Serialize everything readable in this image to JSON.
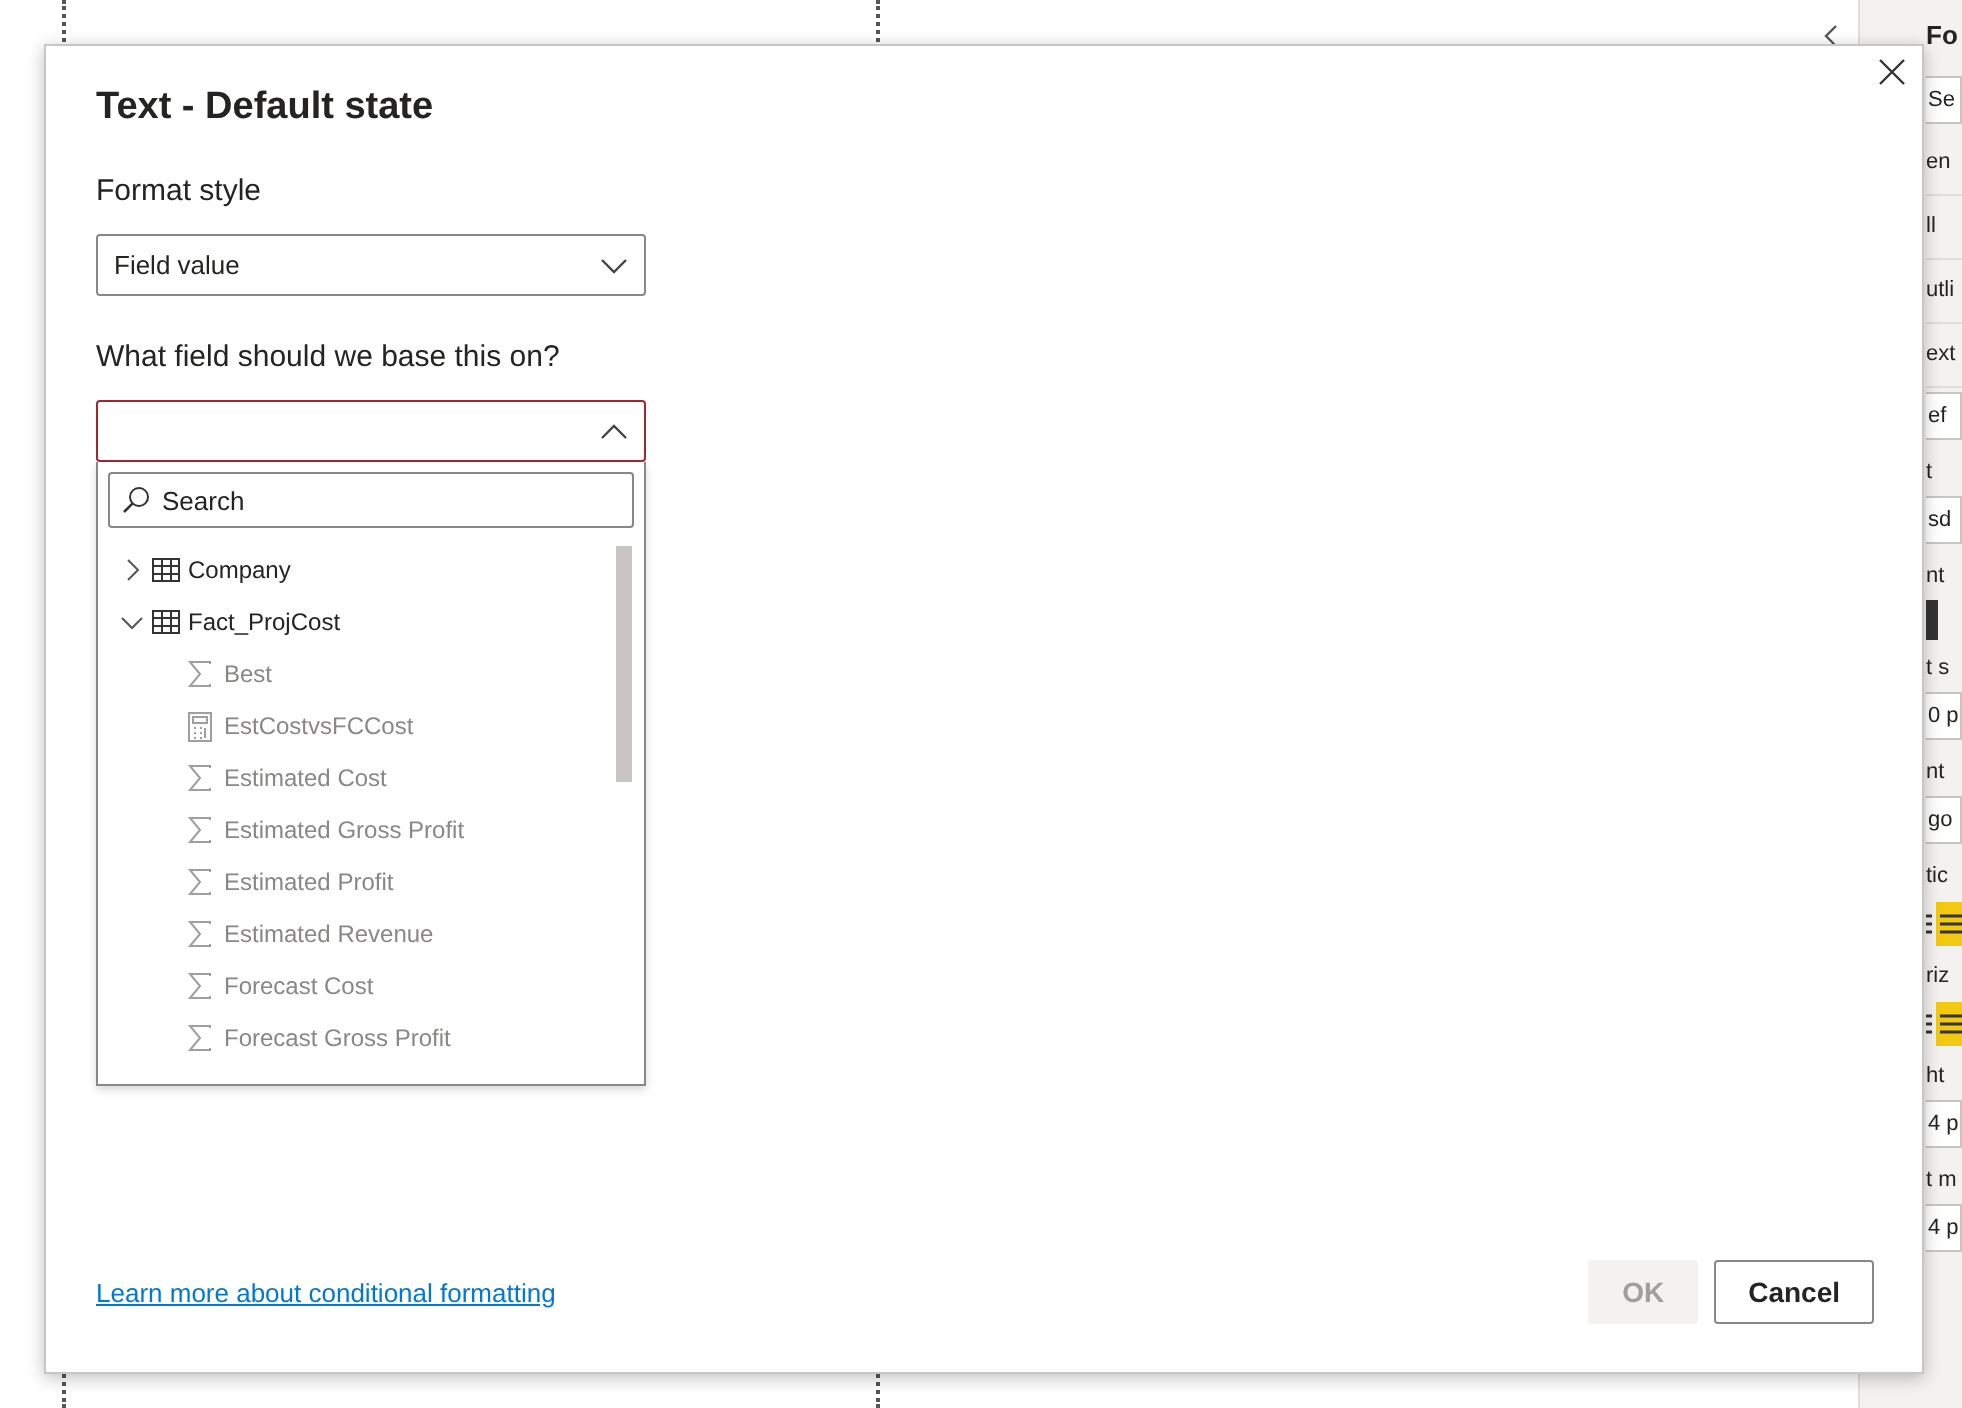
{
  "pane": {
    "title": "Fo",
    "rows": [
      {
        "kind": "field",
        "text": "Se"
      },
      {
        "kind": "section",
        "text": "en"
      },
      {
        "kind": "section",
        "text": "ll"
      },
      {
        "kind": "section",
        "text": "utli"
      },
      {
        "kind": "section",
        "text": "ext"
      },
      {
        "kind": "field",
        "text": "ef"
      },
      {
        "kind": "label",
        "text": "t"
      },
      {
        "kind": "field",
        "text": "sd"
      },
      {
        "kind": "label",
        "text": "nt"
      },
      {
        "kind": "swatch"
      },
      {
        "kind": "label",
        "text": "t s"
      },
      {
        "kind": "field",
        "text": "0",
        "unit": "p"
      },
      {
        "kind": "label",
        "text": "nt"
      },
      {
        "kind": "field",
        "text": "go"
      },
      {
        "kind": "label",
        "text": "tic"
      },
      {
        "kind": "align"
      },
      {
        "kind": "label",
        "text": "riz"
      },
      {
        "kind": "align"
      },
      {
        "kind": "label",
        "text": "ht"
      },
      {
        "kind": "field",
        "text": "4",
        "unit": "p"
      },
      {
        "kind": "label",
        "text": "t m"
      },
      {
        "kind": "field",
        "text": "4",
        "unit": "p"
      }
    ]
  },
  "dialog": {
    "title": "Text - Default state",
    "format_style": {
      "label": "Format style",
      "value": "Field value"
    },
    "base_field": {
      "label": "What field should we base this on?",
      "open": true,
      "invalid": true,
      "search": {
        "placeholder": "Search"
      },
      "tree": [
        {
          "kind": "table",
          "label": "Company",
          "expanded": false
        },
        {
          "kind": "table",
          "label": "Fact_ProjCost",
          "expanded": true,
          "children": [
            {
              "kind": "measure",
              "label": "Best"
            },
            {
              "kind": "calculated",
              "label": "EstCostvsFCCost"
            },
            {
              "kind": "measure",
              "label": "Estimated Cost"
            },
            {
              "kind": "measure",
              "label": "Estimated Gross Profit"
            },
            {
              "kind": "measure",
              "label": "Estimated Profit"
            },
            {
              "kind": "measure",
              "label": "Estimated Revenue"
            },
            {
              "kind": "measure",
              "label": "Forecast Cost"
            },
            {
              "kind": "measure",
              "label": "Forecast Gross Profit"
            }
          ]
        }
      ]
    },
    "link": "Learn more about conditional formatting",
    "buttons": [
      {
        "label": "OK",
        "kind": "primary",
        "disabled": true
      },
      {
        "label": "Cancel",
        "kind": "secondary",
        "disabled": false
      }
    ]
  }
}
